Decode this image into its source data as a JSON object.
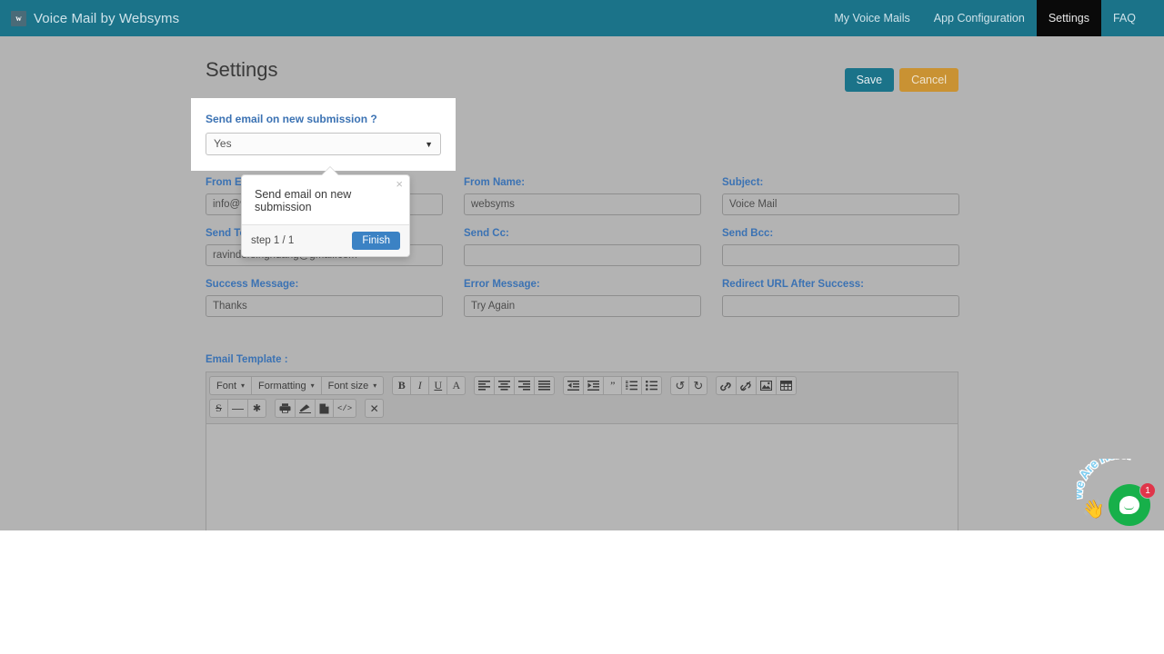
{
  "navbar": {
    "logo_letter": "w",
    "brand": "Voice Mail by Websyms",
    "links": [
      {
        "label": "My Voice Mails",
        "active": false
      },
      {
        "label": "App Configuration",
        "active": false
      },
      {
        "label": "Settings",
        "active": true
      },
      {
        "label": "FAQ",
        "active": false
      }
    ]
  },
  "header": {
    "title": "Settings",
    "save_label": "Save",
    "cancel_label": "Cancel"
  },
  "highlight": {
    "label": "Send email on new submission ?",
    "value": "Yes",
    "caret": "▼"
  },
  "popover": {
    "title": "Send email on new submission",
    "close": "×",
    "step": "step 1 / 1",
    "finish_label": "Finish"
  },
  "form": {
    "rows": [
      [
        {
          "label": "From Email:",
          "value": "info@websyms.com",
          "placeholder": ""
        },
        {
          "label": "From Name:",
          "value": "websyms",
          "placeholder": ""
        },
        {
          "label": "Subject:",
          "value": "Voice Mail",
          "placeholder": ""
        }
      ],
      [
        {
          "label": "Send To:",
          "value": "ravindersinghdang@gmail.com",
          "placeholder": ""
        },
        {
          "label": "Send Cc:",
          "value": "",
          "placeholder": ""
        },
        {
          "label": "Send Bcc:",
          "value": "",
          "placeholder": ""
        }
      ],
      [
        {
          "label": "Success Message:",
          "value": "Thanks",
          "placeholder": ""
        },
        {
          "label": "Error Message:",
          "value": "Try Again",
          "placeholder": ""
        },
        {
          "label": "Redirect URL After Success:",
          "value": "",
          "placeholder": ""
        }
      ]
    ]
  },
  "editor": {
    "label": "Email Template :",
    "content": "",
    "toolbar_row1": {
      "g1": [
        {
          "name": "font-dropdown",
          "text": "Font",
          "dropdown": true
        },
        {
          "name": "formatting-dropdown",
          "text": "Formatting",
          "dropdown": true
        },
        {
          "name": "font-size-dropdown",
          "text": "Font size",
          "dropdown": true
        }
      ],
      "g2": [
        {
          "name": "bold-icon",
          "glyph": "B"
        },
        {
          "name": "italic-icon",
          "glyph": "I"
        },
        {
          "name": "underline-icon",
          "glyph": "U"
        },
        {
          "name": "font-color-icon",
          "glyph": "A"
        }
      ],
      "g3": [
        {
          "name": "align-left-icon"
        },
        {
          "name": "align-center-icon"
        },
        {
          "name": "align-right-icon"
        },
        {
          "name": "align-justify-icon"
        }
      ],
      "g4": [
        {
          "name": "outdent-icon"
        },
        {
          "name": "indent-icon"
        },
        {
          "name": "blockquote-icon",
          "glyph": "❞"
        },
        {
          "name": "ordered-list-icon"
        },
        {
          "name": "unordered-list-icon"
        }
      ],
      "g5": [
        {
          "name": "undo-icon",
          "glyph": "↺"
        },
        {
          "name": "redo-icon",
          "glyph": "↻"
        }
      ],
      "g6": [
        {
          "name": "link-icon"
        },
        {
          "name": "unlink-icon"
        },
        {
          "name": "image-icon"
        },
        {
          "name": "table-icon"
        }
      ]
    },
    "toolbar_row2": {
      "g1": [
        {
          "name": "strikethrough-icon",
          "glyph": "S"
        },
        {
          "name": "horizontal-rule-icon",
          "glyph": "—"
        },
        {
          "name": "special-character-icon",
          "glyph": "✱"
        }
      ],
      "g2": [
        {
          "name": "print-icon"
        },
        {
          "name": "clear-formatting-icon"
        },
        {
          "name": "page-break-icon"
        },
        {
          "name": "code-view-icon",
          "glyph": "</>"
        }
      ],
      "g3": [
        {
          "name": "fullscreen-icon",
          "glyph": "✥"
        }
      ]
    }
  },
  "chat_widget": {
    "arc_text": "We Are Here!",
    "badge_count": "1",
    "wave": "👋"
  }
}
